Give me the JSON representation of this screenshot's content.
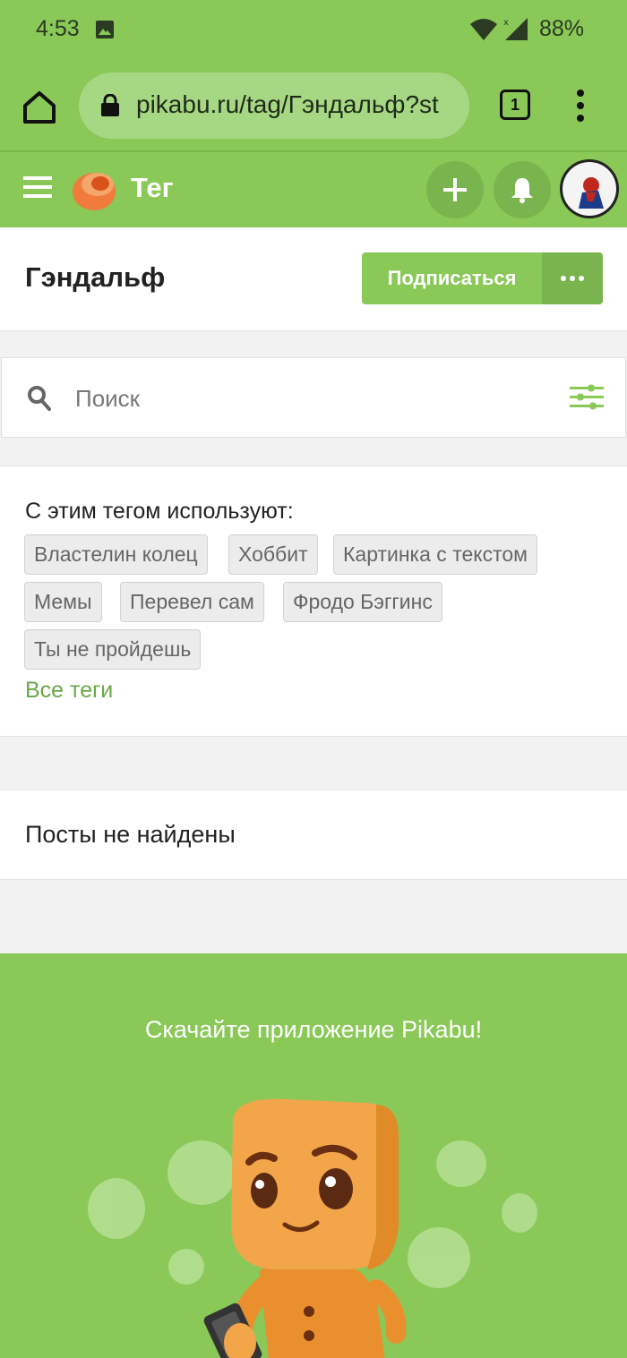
{
  "status_bar": {
    "time": "4:53",
    "battery": "88%"
  },
  "browser": {
    "url": "pikabu.ru/tag/Гэндальф?st",
    "tab_count": "1"
  },
  "header": {
    "title": "Тег"
  },
  "tag": {
    "name": "Гэндальф",
    "subscribe_label": "Подписаться"
  },
  "search": {
    "placeholder": "Поиск"
  },
  "related": {
    "title": "С этим тегом используют:",
    "tags": [
      "Властелин колец",
      "Хоббит",
      "Картинка с текстом",
      "Мемы",
      "Перевел сам",
      "Фродо Бэггинс",
      "Ты не пройдешь"
    ],
    "all_tags_label": "Все теги"
  },
  "empty_state": {
    "text": "Посты не найдены"
  },
  "promo": {
    "text": "Скачайте приложение Pikabu!"
  },
  "colors": {
    "brand_green": "#8ac858",
    "dark_green": "#7ab44e",
    "link_green": "#6aa84a",
    "logo_orange": "#f07b3a"
  }
}
